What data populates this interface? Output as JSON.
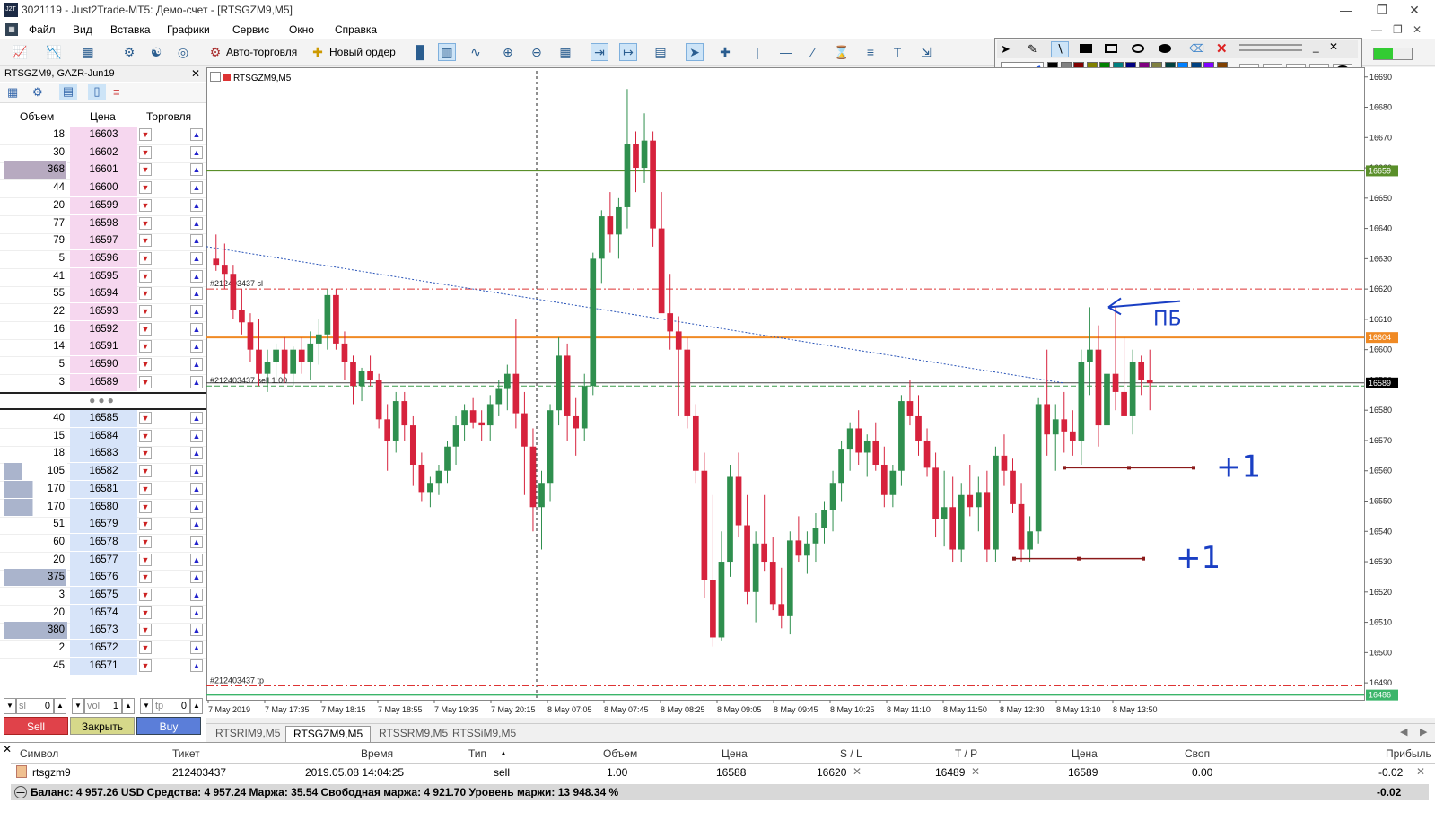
{
  "window": {
    "title": "3021119 - Just2Trade-MT5: Демо-счет - [RTSGZM9,M5]",
    "logo": "J2T"
  },
  "menu": [
    "Файл",
    "Вид",
    "Вставка",
    "Графики",
    "Сервис",
    "Окно",
    "Справка"
  ],
  "toolbar": {
    "autotrading": "Авто-торговля",
    "new_order": "Новый ордер"
  },
  "depth": {
    "title": "RTSGZM9, GAZR-Jun19",
    "col_volume": "Объем",
    "col_price": "Цена",
    "col_trade": "Торговля",
    "asks": [
      {
        "vol": "18",
        "price": "16603"
      },
      {
        "vol": "30",
        "price": "16602"
      },
      {
        "vol": "368",
        "price": "16601"
      },
      {
        "vol": "44",
        "price": "16600"
      },
      {
        "vol": "20",
        "price": "16599"
      },
      {
        "vol": "77",
        "price": "16598"
      },
      {
        "vol": "79",
        "price": "16597"
      },
      {
        "vol": "5",
        "price": "16596"
      },
      {
        "vol": "41",
        "price": "16595"
      },
      {
        "vol": "55",
        "price": "16594"
      },
      {
        "vol": "22",
        "price": "16593"
      },
      {
        "vol": "16",
        "price": "16592"
      },
      {
        "vol": "14",
        "price": "16591"
      },
      {
        "vol": "5",
        "price": "16590"
      },
      {
        "vol": "3",
        "price": "16589"
      }
    ],
    "bids": [
      {
        "vol": "40",
        "price": "16585"
      },
      {
        "vol": "15",
        "price": "16584"
      },
      {
        "vol": "18",
        "price": "16583"
      },
      {
        "vol": "105",
        "price": "16582"
      },
      {
        "vol": "170",
        "price": "16581"
      },
      {
        "vol": "170",
        "price": "16580"
      },
      {
        "vol": "51",
        "price": "16579"
      },
      {
        "vol": "60",
        "price": "16578"
      },
      {
        "vol": "20",
        "price": "16577"
      },
      {
        "vol": "375",
        "price": "16576"
      },
      {
        "vol": "3",
        "price": "16575"
      },
      {
        "vol": "20",
        "price": "16574"
      },
      {
        "vol": "380",
        "price": "16573"
      },
      {
        "vol": "2",
        "price": "16572"
      },
      {
        "vol": "45",
        "price": "16571"
      }
    ],
    "sl_label": "sl",
    "sl_value": "0",
    "vol_label": "vol",
    "vol_value": "1",
    "tp_label": "tp",
    "tp_value": "0",
    "sell": "Sell",
    "close": "Закрыть",
    "buy": "Buy"
  },
  "chart_data": {
    "type": "candlestick",
    "symbol_label": "RTSGZM9,M5",
    "ylim": [
      16485,
      16692
    ],
    "y_ticks": [
      16690,
      16680,
      16670,
      16660,
      16650,
      16640,
      16630,
      16620,
      16610,
      16600,
      16590,
      16580,
      16570,
      16560,
      16550,
      16540,
      16530,
      16520,
      16510,
      16500,
      16490
    ],
    "x_ticks": [
      "7 May 2019",
      "7 May 17:35",
      "7 May 18:15",
      "7 May 18:55",
      "7 May 19:35",
      "7 May 20:15",
      "8 May 07:05",
      "8 May 07:45",
      "8 May 08:25",
      "8 May 09:05",
      "8 May 09:45",
      "8 May 10:25",
      "8 May 11:10",
      "8 May 11:50",
      "8 May 12:30",
      "8 May 13:10",
      "8 May 13:50"
    ],
    "price_tags": {
      "green": "16659",
      "orange": "16604",
      "current": "16589",
      "lower": "16486"
    },
    "order_labels": {
      "sl": "#212403437 sl",
      "entry": "#212403437 sell 1.00",
      "tp": "#212403437 tp"
    },
    "levels": {
      "green": 16659,
      "sl": 16620,
      "orange": 16604,
      "current": 16589,
      "entry": 16588,
      "tp": 16489,
      "lower": 16486
    },
    "annotations": {
      "pb": "ПБ",
      "plus1_a": "+1",
      "plus1_b": "+1"
    },
    "candles": [
      [
        16630,
        16638,
        16626,
        16628
      ],
      [
        16628,
        16635,
        16620,
        16625
      ],
      [
        16625,
        16628,
        16610,
        16613
      ],
      [
        16613,
        16620,
        16605,
        16609
      ],
      [
        16609,
        16612,
        16596,
        16600
      ],
      [
        16600,
        16610,
        16588,
        16592
      ],
      [
        16592,
        16600,
        16586,
        16596
      ],
      [
        16596,
        16602,
        16590,
        16600
      ],
      [
        16600,
        16604,
        16589,
        16592
      ],
      [
        16592,
        16601,
        16588,
        16600
      ],
      [
        16600,
        16604,
        16592,
        16596
      ],
      [
        16596,
        16606,
        16590,
        16602
      ],
      [
        16602,
        16610,
        16595,
        16605
      ],
      [
        16605,
        16620,
        16600,
        16618
      ],
      [
        16618,
        16620,
        16600,
        16602
      ],
      [
        16602,
        16606,
        16590,
        16596
      ],
      [
        16596,
        16598,
        16582,
        16588
      ],
      [
        16588,
        16594,
        16583,
        16593
      ],
      [
        16593,
        16598,
        16588,
        16590
      ],
      [
        16590,
        16592,
        16574,
        16577
      ],
      [
        16577,
        16582,
        16560,
        16570
      ],
      [
        16570,
        16586,
        16566,
        16583
      ],
      [
        16583,
        16586,
        16570,
        16575
      ],
      [
        16575,
        16578,
        16555,
        16562
      ],
      [
        16562,
        16566,
        16550,
        16553
      ],
      [
        16553,
        16558,
        16548,
        16556
      ],
      [
        16556,
        16562,
        16552,
        16560
      ],
      [
        16560,
        16570,
        16556,
        16568
      ],
      [
        16568,
        16578,
        16562,
        16575
      ],
      [
        16575,
        16582,
        16570,
        16580
      ],
      [
        16580,
        16584,
        16574,
        16576
      ],
      [
        16576,
        16580,
        16570,
        16575
      ],
      [
        16575,
        16585,
        16570,
        16582
      ],
      [
        16582,
        16590,
        16578,
        16587
      ],
      [
        16587,
        16595,
        16580,
        16592
      ],
      [
        16592,
        16610,
        16574,
        16579
      ],
      [
        16579,
        16586,
        16552,
        16568
      ],
      [
        16568,
        16574,
        16540,
        16548
      ],
      [
        16548,
        16560,
        16534,
        16556
      ],
      [
        16556,
        16582,
        16550,
        16580
      ],
      [
        16580,
        16604,
        16575,
        16598
      ],
      [
        16598,
        16602,
        16570,
        16578
      ],
      [
        16578,
        16584,
        16565,
        16574
      ],
      [
        16574,
        16592,
        16570,
        16588
      ],
      [
        16588,
        16632,
        16585,
        16630
      ],
      [
        16630,
        16646,
        16622,
        16644
      ],
      [
        16644,
        16652,
        16632,
        16638
      ],
      [
        16638,
        16650,
        16630,
        16647
      ],
      [
        16647,
        16686,
        16640,
        16668
      ],
      [
        16668,
        16672,
        16652,
        16660
      ],
      [
        16660,
        16678,
        16655,
        16669
      ],
      [
        16669,
        16672,
        16634,
        16640
      ],
      [
        16640,
        16652,
        16622,
        16612
      ],
      [
        16612,
        16625,
        16600,
        16606
      ],
      [
        16606,
        16611,
        16578,
        16600
      ],
      [
        16600,
        16604,
        16574,
        16578
      ],
      [
        16578,
        16582,
        16556,
        16560
      ],
      [
        16560,
        16566,
        16518,
        16524
      ],
      [
        16524,
        16552,
        16502,
        16505
      ],
      [
        16505,
        16540,
        16504,
        16530
      ],
      [
        16530,
        16562,
        16525,
        16558
      ],
      [
        16558,
        16566,
        16538,
        16542
      ],
      [
        16542,
        16552,
        16516,
        16520
      ],
      [
        16520,
        16540,
        16510,
        16536
      ],
      [
        16536,
        16552,
        16527,
        16530
      ],
      [
        16530,
        16538,
        16514,
        16516
      ],
      [
        16516,
        16528,
        16508,
        16512
      ],
      [
        16512,
        16540,
        16506,
        16537
      ],
      [
        16537,
        16545,
        16530,
        16532
      ],
      [
        16532,
        16540,
        16526,
        16536
      ],
      [
        16536,
        16546,
        16530,
        16541
      ],
      [
        16541,
        16550,
        16536,
        16547
      ],
      [
        16547,
        16560,
        16540,
        16556
      ],
      [
        16556,
        16570,
        16550,
        16567
      ],
      [
        16567,
        16576,
        16560,
        16574
      ],
      [
        16574,
        16580,
        16562,
        16566
      ],
      [
        16566,
        16572,
        16558,
        16570
      ],
      [
        16570,
        16576,
        16560,
        16562
      ],
      [
        16562,
        16568,
        16548,
        16552
      ],
      [
        16552,
        16562,
        16548,
        16560
      ],
      [
        16560,
        16585,
        16555,
        16583
      ],
      [
        16583,
        16590,
        16575,
        16578
      ],
      [
        16578,
        16585,
        16565,
        16570
      ],
      [
        16570,
        16574,
        16558,
        16561
      ],
      [
        16561,
        16566,
        16538,
        16544
      ],
      [
        16544,
        16560,
        16535,
        16548
      ],
      [
        16548,
        16558,
        16530,
        16534
      ],
      [
        16534,
        16556,
        16530,
        16552
      ],
      [
        16552,
        16562,
        16545,
        16548
      ],
      [
        16548,
        16558,
        16540,
        16553
      ],
      [
        16553,
        16560,
        16530,
        16534
      ],
      [
        16534,
        16568,
        16530,
        16565
      ],
      [
        16565,
        16572,
        16555,
        16560
      ],
      [
        16560,
        16564,
        16546,
        16549
      ],
      [
        16549,
        16556,
        16530,
        16534
      ],
      [
        16534,
        16545,
        16530,
        16540
      ],
      [
        16540,
        16584,
        16536,
        16582
      ],
      [
        16582,
        16600,
        16565,
        16572
      ],
      [
        16572,
        16582,
        16560,
        16577
      ],
      [
        16577,
        16586,
        16566,
        16573
      ],
      [
        16573,
        16580,
        16565,
        16570
      ],
      [
        16570,
        16600,
        16562,
        16596
      ],
      [
        16596,
        16614,
        16585,
        16600
      ],
      [
        16600,
        16608,
        16568,
        16575
      ],
      [
        16575,
        16586,
        16570,
        16592
      ],
      [
        16592,
        16614,
        16580,
        16586
      ],
      [
        16586,
        16604,
        16578,
        16578
      ],
      [
        16578,
        16600,
        16572,
        16596
      ],
      [
        16596,
        16598,
        16585,
        16590
      ],
      [
        16590,
        16600,
        16580,
        16589
      ]
    ]
  },
  "chart_tabs": [
    "RTSRIM9,M5",
    "RTSGZM9,M5",
    "RTSSRM9,M5",
    "RTSSiM9,M5"
  ],
  "terminal": {
    "headers": {
      "symbol": "Символ",
      "ticket": "Тикет",
      "time": "Время",
      "type": "Тип",
      "volume": "Объем",
      "price": "Цена",
      "sl": "S / L",
      "tp": "T / P",
      "price2": "Цена",
      "swap": "Своп",
      "profit": "Прибыль"
    },
    "row": {
      "symbol": "rtsgzm9",
      "ticket": "212403437",
      "time": "2019.05.08 14:04:25",
      "type": "sell",
      "volume": "1.00",
      "price": "16588",
      "sl": "16620",
      "tp": "16489",
      "price2": "16589",
      "swap": "0.00",
      "profit": "-0.02"
    },
    "balance": "Баланс: 4 957.26 USD  Средства: 4 957.24  Маржа: 35.54  Свободная маржа: 4 921.70  Уровень маржи: 13 948.34 %",
    "total_profit": "-0.02"
  },
  "colors": {
    "bull": "#2f8f4e",
    "bear": "#d6223c",
    "sl_line": "#d33",
    "green_level": "#5a8f2a",
    "orange_level": "#f08a24",
    "ask_bg": "#f6d7ef",
    "bid_bg": "#d7e4f9"
  }
}
